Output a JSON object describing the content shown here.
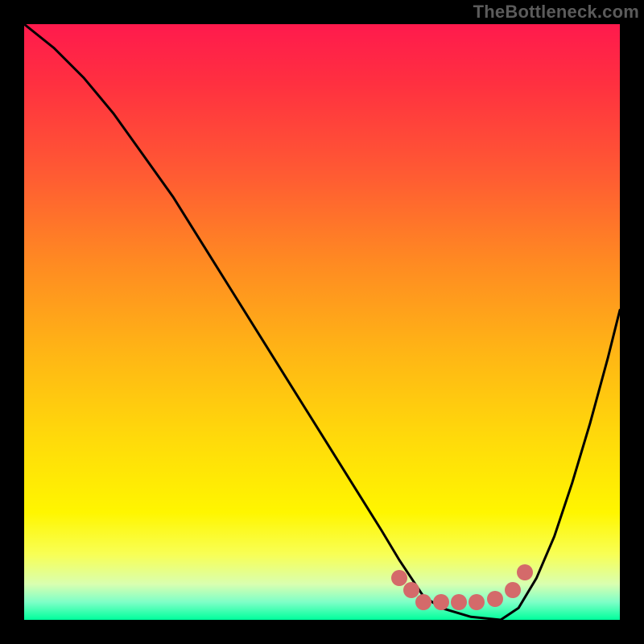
{
  "watermark": "TheBottleneck.com",
  "chart_data": {
    "type": "line",
    "title": "",
    "xlabel": "",
    "ylabel": "",
    "xlim": [
      0,
      100
    ],
    "ylim": [
      0,
      100
    ],
    "grid": false,
    "colors": {
      "gradient_top": "#ff1a4d",
      "gradient_mid": "#ffdb0a",
      "gradient_bottom": "#00ff9c",
      "curve": "#000000",
      "markers": "#d46a6a",
      "frame": "#000000"
    },
    "series": [
      {
        "name": "left-curve",
        "x": [
          0,
          5,
          10,
          15,
          20,
          25,
          30,
          35,
          40,
          45,
          50,
          55,
          60,
          63,
          65,
          67,
          70,
          75,
          80
        ],
        "y": [
          100,
          96,
          91,
          85,
          78,
          71,
          63,
          55,
          47,
          39,
          31,
          23,
          15,
          10,
          7,
          4,
          2,
          0.5,
          0
        ]
      },
      {
        "name": "right-curve",
        "x": [
          80,
          83,
          86,
          89,
          92,
          95,
          98,
          100
        ],
        "y": [
          0,
          2,
          7,
          14,
          23,
          33,
          44,
          52
        ]
      }
    ],
    "markers": [
      {
        "name": "left-endpoint-marker",
        "x": 63,
        "y": 7
      },
      {
        "name": "flat-start-marker",
        "x": 65,
        "y": 5
      },
      {
        "name": "flat-marker-1",
        "x": 67,
        "y": 3
      },
      {
        "name": "flat-marker-2",
        "x": 70,
        "y": 3
      },
      {
        "name": "flat-marker-3",
        "x": 73,
        "y": 3
      },
      {
        "name": "flat-marker-4",
        "x": 76,
        "y": 3
      },
      {
        "name": "flat-end-marker",
        "x": 79,
        "y": 3.5
      },
      {
        "name": "right-bottom-marker",
        "x": 82,
        "y": 5
      },
      {
        "name": "right-start-marker",
        "x": 84,
        "y": 8
      }
    ]
  }
}
